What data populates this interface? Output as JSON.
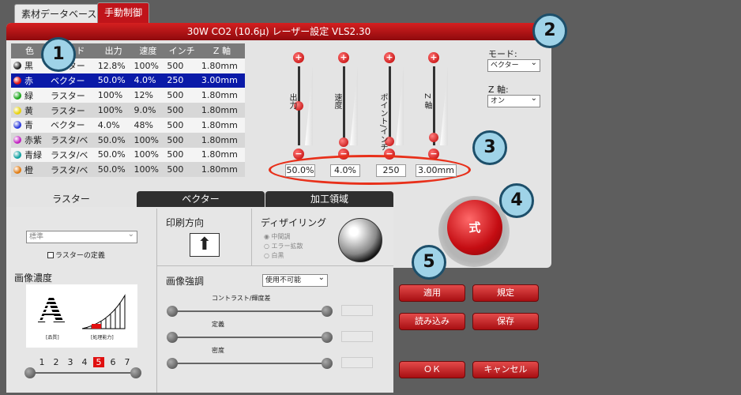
{
  "tabs": {
    "material_db": "素材データベース",
    "manual_control": "手動制御"
  },
  "title": "30W CO2 (10.6μ) レーザー設定 VLS2.30",
  "table": {
    "headers": [
      "色",
      "モード",
      "出力",
      "速度",
      "インチ",
      "Z 軸"
    ],
    "rows": [
      {
        "color": "黒",
        "mode": "ラスター",
        "power": "12.8%",
        "speed": "100%",
        "ppi": "500",
        "z": "1.80mm",
        "dot": "#222222"
      },
      {
        "color": "赤",
        "mode": "ベクター",
        "power": "50.0%",
        "speed": "4.0%",
        "ppi": "250",
        "z": "3.00mm",
        "dot": "#e01010"
      },
      {
        "color": "緑",
        "mode": "ラスター",
        "power": "100%",
        "speed": "12%",
        "ppi": "500",
        "z": "1.80mm",
        "dot": "#1aa51a"
      },
      {
        "color": "黄",
        "mode": "ラスター",
        "power": "100%",
        "speed": "9.0%",
        "ppi": "500",
        "z": "1.80mm",
        "dot": "#e8d20a"
      },
      {
        "color": "青",
        "mode": "ベクター",
        "power": "4.0%",
        "speed": "48%",
        "ppi": "500",
        "z": "1.80mm",
        "dot": "#2a3adb"
      },
      {
        "color": "赤紫",
        "mode": "ラスタ/ベ",
        "power": "50.0%",
        "speed": "100%",
        "ppi": "500",
        "z": "1.80mm",
        "dot": "#c020c0"
      },
      {
        "color": "青緑",
        "mode": "ラスタ/ベ",
        "power": "50.0%",
        "speed": "100%",
        "ppi": "500",
        "z": "1.80mm",
        "dot": "#10a0a0"
      },
      {
        "color": "橙",
        "mode": "ラスタ/ベ",
        "power": "50.0%",
        "speed": "100%",
        "ppi": "500",
        "z": "1.80mm",
        "dot": "#e07a10"
      }
    ]
  },
  "sliders": [
    {
      "label": "出力",
      "value": "50.0%",
      "level": 0.5
    },
    {
      "label": "速度",
      "value": "4.0%",
      "level": 0.04
    },
    {
      "label": "ポイント/インチ",
      "value": "250",
      "level": 0.05
    },
    {
      "label": "Z 軸",
      "value": "3.00mm",
      "level": 0.1
    }
  ],
  "mode": {
    "label": "モード:",
    "value": "ベクター"
  },
  "zaxis": {
    "label": "Z 軸:",
    "value": "オン"
  },
  "big_button": "式",
  "callouts": [
    "1",
    "2",
    "3",
    "4",
    "5"
  ],
  "lower_tabs": [
    "ラスター",
    "ベクター",
    "加工領域"
  ],
  "raster": {
    "preset": "標準",
    "define_raster": "ラスターの定義",
    "image_density": "画像濃度",
    "quality_label": "[品質]",
    "speed_label": "[処理能力]",
    "density_steps": [
      "1",
      "2",
      "3",
      "4",
      "5",
      "6",
      "7"
    ],
    "density_selected": "5",
    "print_direction": "印刷方向",
    "dithering": "ディザイリング",
    "dither_options": [
      "中間調",
      "エラー拡散",
      "白黒"
    ],
    "image_enhance": "画像強調",
    "enhance_select": "使用不可能",
    "enhance_sliders": [
      "コントラスト/輝度差",
      "定義",
      "密度"
    ]
  },
  "buttons": {
    "apply": "適用",
    "default": "規定",
    "load": "読み込み",
    "save": "保存",
    "ok": "ＯＫ",
    "cancel": "キャンセル"
  }
}
